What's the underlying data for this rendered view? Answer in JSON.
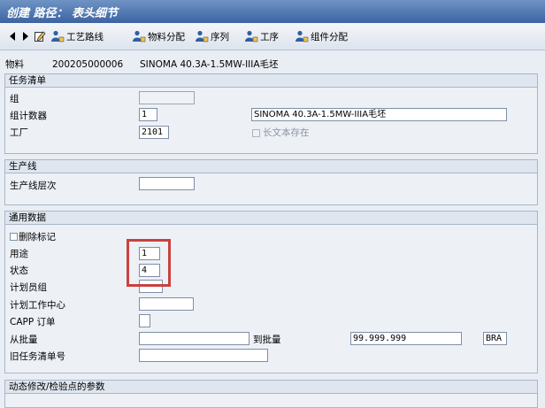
{
  "window": {
    "title": "创建 路径： 表头细节"
  },
  "toolbar": {
    "items": [
      "工艺路线",
      "物料分配",
      "序列",
      "工序",
      "组件分配"
    ]
  },
  "header": {
    "material_label": "物料",
    "material_number": "200205000006",
    "material_desc": "SINOMA 40.3A-1.5MW-IIIA毛坯"
  },
  "task_list": {
    "section_title": "任务清单",
    "group_label": "组",
    "group_value": "",
    "counter_label": "组计数器",
    "counter_value": "1",
    "counter_desc": "SINOMA 40.3A-1.5MW-IIIA毛坯",
    "plant_label": "工厂",
    "plant_value": "2101",
    "long_text_label": "长文本存在"
  },
  "production_line": {
    "section_title": "生产线",
    "level_label": "生产线层次",
    "level_value": ""
  },
  "general_data": {
    "section_title": "通用数据",
    "deletion_flag_label": "删除标记",
    "usage_label": "用途",
    "usage_value": "1",
    "status_label": "状态",
    "status_value": "4",
    "planner_group_label": "计划员组",
    "planner_group_value": "",
    "work_center_label": "计划工作中心",
    "work_center_value": "",
    "capp_label": "CAPP 订单",
    "from_lot_label": "从批量",
    "from_lot_value": "",
    "to_lot_label": "到批量",
    "to_lot_value": "99.999.999",
    "unit_value": "BRA",
    "old_task_list_label": "旧任务清单号",
    "old_task_list_value": ""
  },
  "next_section": {
    "title": "动态修改/检验点的参数"
  },
  "colors": {
    "highlight": "#c9413c",
    "titlebar": "#4a6fa8"
  }
}
